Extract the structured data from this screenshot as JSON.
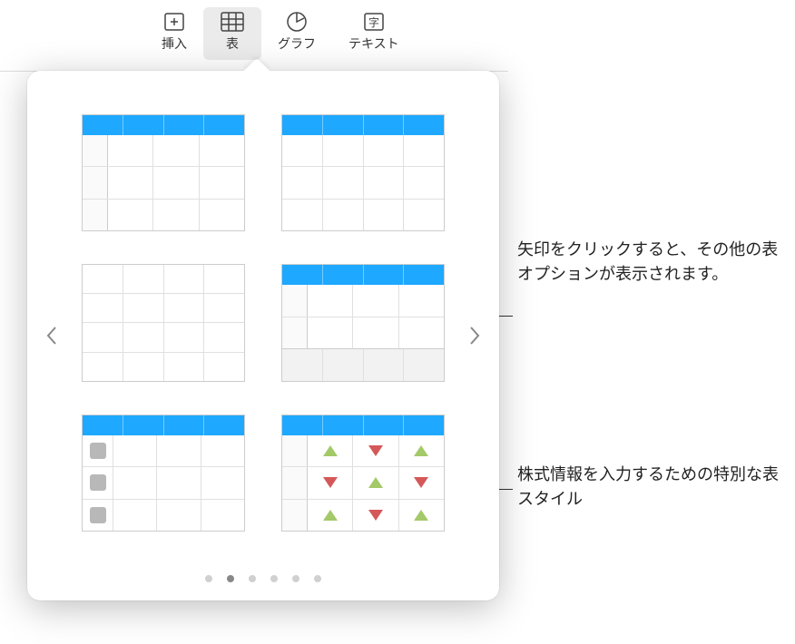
{
  "toolbar": {
    "insert": {
      "label": "挿入"
    },
    "table": {
      "label": "表"
    },
    "chart": {
      "label": "グラフ"
    },
    "text": {
      "label": "テキスト"
    }
  },
  "popover": {
    "page_count": 6,
    "active_page": 2,
    "styles": [
      {
        "name": "header-side-blue"
      },
      {
        "name": "header-blue"
      },
      {
        "name": "plain-grid"
      },
      {
        "name": "header-footer"
      },
      {
        "name": "chip-rows"
      },
      {
        "name": "stock-indicators"
      }
    ]
  },
  "callouts": {
    "arrow_hint": "矢印をクリックすると、その他の表オプションが表示されます。",
    "stock_hint": "株式情報を入力するための特別な表スタイル"
  },
  "colors": {
    "accent": "#1ea8ff",
    "up": "#a3c968",
    "down": "#d45858"
  }
}
